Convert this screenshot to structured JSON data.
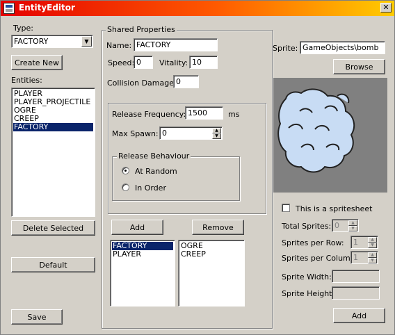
{
  "window": {
    "title": "EntityEditor",
    "close_glyph": "✕"
  },
  "left": {
    "type_label": "Type:",
    "type_value": "FACTORY",
    "create_new": "Create New",
    "entities_label": "Entities:",
    "entities": [
      "PLAYER",
      "PLAYER_PROJECTILE",
      "OGRE",
      "CREEP",
      "FACTORY"
    ],
    "selected_entity": "FACTORY",
    "delete_selected": "Delete Selected",
    "default": "Default",
    "save": "Save"
  },
  "shared": {
    "group_title": "Shared Properties",
    "name_label": "Name:",
    "name_value": "FACTORY",
    "speed_label": "Speed:",
    "speed_value": "0",
    "vitality_label": "Vitality:",
    "vitality_value": "10",
    "collision_label": "Collision Damage:",
    "collision_value": "0",
    "release_freq_label": "Release Frequency:",
    "release_freq_value": "1500",
    "release_freq_unit": "ms",
    "max_spawn_label": "Max Spawn:",
    "max_spawn_value": "0",
    "release_behaviour_title": "Release Behaviour",
    "at_random": "At Random",
    "in_order": "In Order",
    "behaviour_selected": "At Random",
    "add": "Add",
    "remove": "Remove",
    "left_list": [
      "FACTORY",
      "PLAYER"
    ],
    "left_list_selected": "FACTORY",
    "right_list": [
      "OGRE",
      "CREEP"
    ]
  },
  "sprite": {
    "sprite_label": "Sprite:",
    "sprite_value": "GameObjects\\bomb",
    "browse": "Browse",
    "spritesheet_label": "This is a spritesheet",
    "spritesheet_checked": false,
    "total_sprites_label": "Total Sprites:",
    "total_sprites_value": "0",
    "per_row_label": "Sprites per Row:",
    "per_row_value": "1",
    "per_column_label": "Sprites per Column:",
    "per_column_value": "1",
    "width_label": "Sprite Width:",
    "width_value": "",
    "height_label": "Sprite Height:",
    "height_value": "",
    "add": "Add"
  },
  "colors": {
    "face": "#d4d0c8",
    "select": "#0a246a",
    "preview_bg": "#808080",
    "cloud": "#c8dcf4"
  }
}
